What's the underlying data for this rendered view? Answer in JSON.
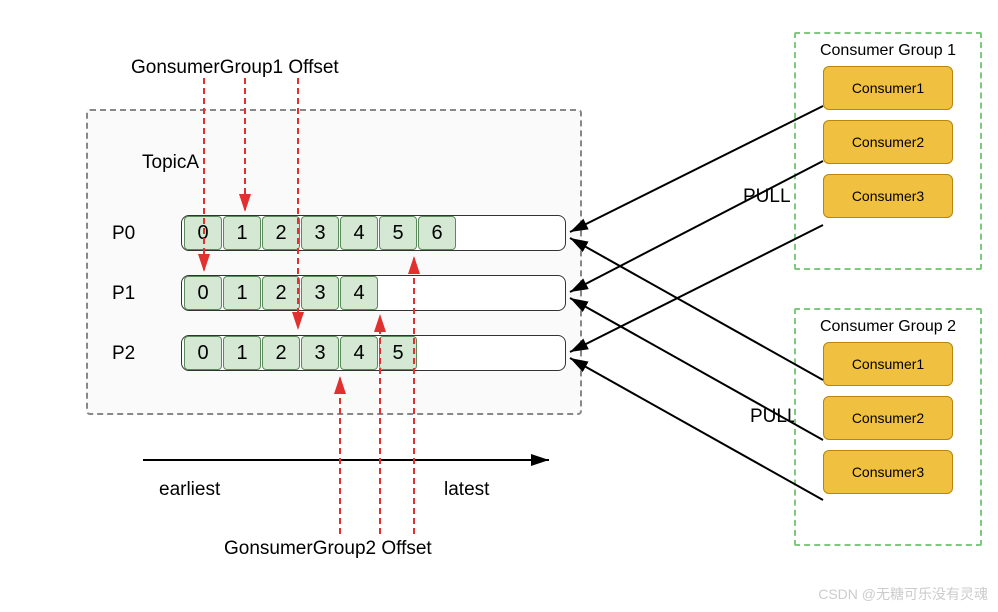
{
  "topic_label": "TopicA",
  "offset_label_top": "GonsumerGroup1 Offset",
  "offset_label_bottom": "GonsumerGroup2 Offset",
  "axis": {
    "earliest": "earliest",
    "latest": "latest"
  },
  "partitions": [
    {
      "label": "P0",
      "cells": [
        "0",
        "1",
        "2",
        "3",
        "4",
        "5",
        "6"
      ]
    },
    {
      "label": "P1",
      "cells": [
        "0",
        "1",
        "2",
        "3",
        "4"
      ]
    },
    {
      "label": "P2",
      "cells": [
        "0",
        "1",
        "2",
        "3",
        "4",
        "5"
      ]
    }
  ],
  "pull_label": "PULL",
  "groups": [
    {
      "title": "Consumer Group 1",
      "consumers": [
        "Consumer1",
        "Consumer2",
        "Consumer3"
      ]
    },
    {
      "title": "Consumer Group 2",
      "consumers": [
        "Consumer1",
        "Consumer2",
        "Consumer3"
      ]
    }
  ],
  "chart_data": {
    "type": "diagram",
    "topic": "TopicA",
    "partitions_offsets": {
      "P0": [
        0,
        1,
        2,
        3,
        4,
        5,
        6
      ],
      "P1": [
        0,
        1,
        2,
        3,
        4
      ],
      "P2": [
        0,
        1,
        2,
        3,
        4,
        5
      ]
    },
    "consumer_group_1_offsets": {
      "P0": 1,
      "P1": 0,
      "P2": 2
    },
    "consumer_group_2_offsets": {
      "P0": 5,
      "P1": 4,
      "P2": 4
    },
    "consumer_groups": {
      "Consumer Group 1": [
        "Consumer1",
        "Consumer2",
        "Consumer3"
      ],
      "Consumer Group 2": [
        "Consumer1",
        "Consumer2",
        "Consumer3"
      ]
    },
    "direction": "earliest → latest",
    "action": "PULL"
  },
  "watermark": "CSDN @无糖可乐没有灵魂"
}
